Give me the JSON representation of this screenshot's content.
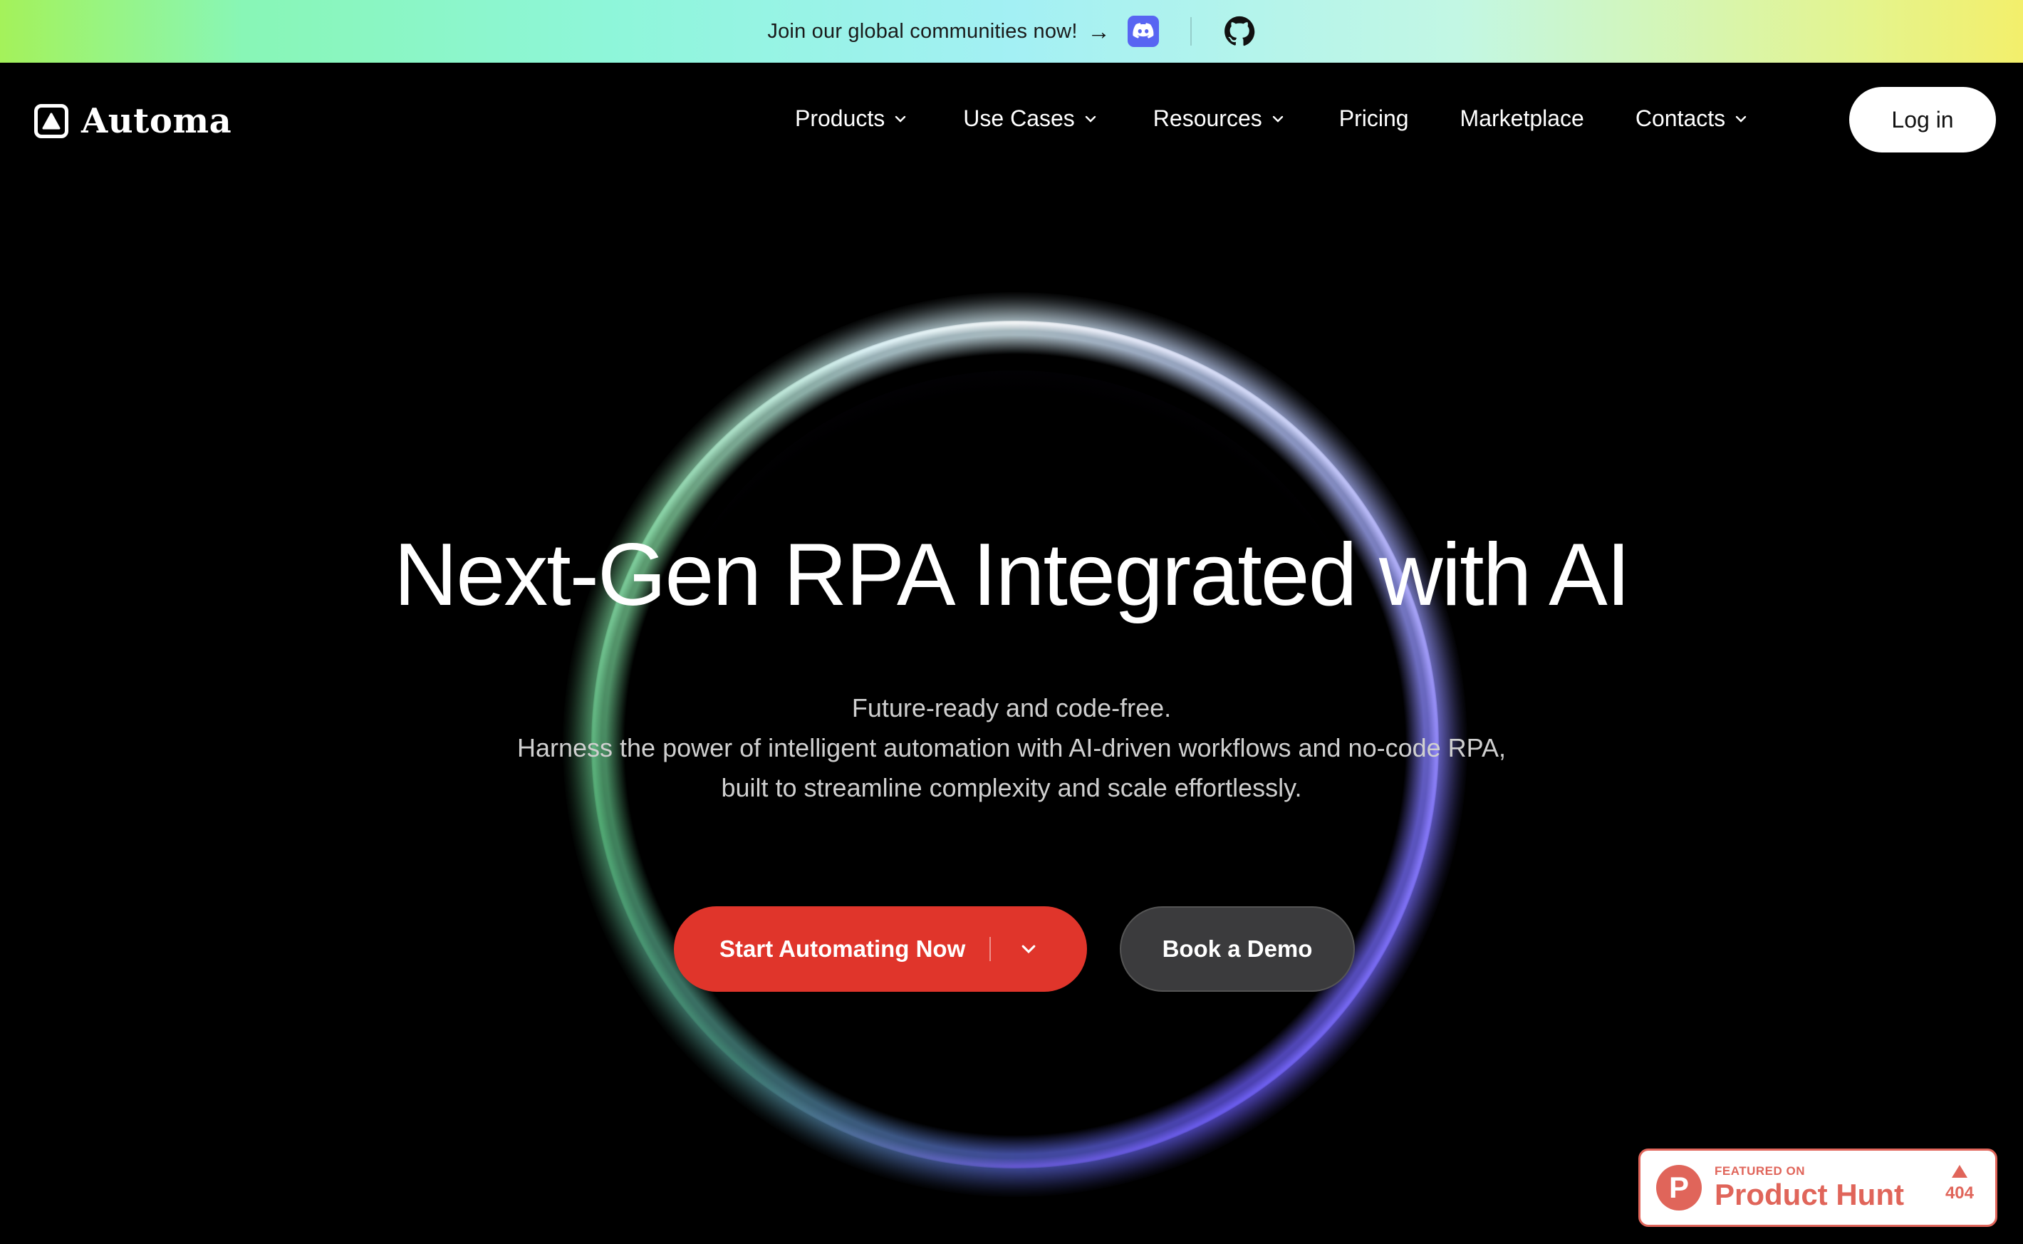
{
  "announcement": {
    "text": "Join our global communities now!",
    "arrow": "→",
    "icons": [
      "discord-icon",
      "github-icon"
    ]
  },
  "brand": {
    "name": "Automa"
  },
  "nav": {
    "items": [
      {
        "label": "Products",
        "has_dropdown": true
      },
      {
        "label": "Use Cases",
        "has_dropdown": true
      },
      {
        "label": "Resources",
        "has_dropdown": true
      },
      {
        "label": "Pricing",
        "has_dropdown": false
      },
      {
        "label": "Marketplace",
        "has_dropdown": false
      },
      {
        "label": "Contacts",
        "has_dropdown": true
      }
    ],
    "login_label": "Log in"
  },
  "hero": {
    "title": "Next-Gen RPA Integrated with AI",
    "subtitle_lines": [
      "Future-ready and code-free.",
      "Harness the power of intelligent automation with AI-driven workflows and no-code RPA,",
      "built to streamline complexity and scale effortlessly."
    ],
    "primary_cta": "Start Automating Now",
    "secondary_cta": "Book a Demo"
  },
  "product_hunt": {
    "small": "FEATURED ON",
    "big": "Product Hunt",
    "logo_letter": "P",
    "votes": "404"
  },
  "colors": {
    "primary_cta": "#e0352b",
    "secondary_cta": "#3b3b3d",
    "discord": "#5865f2",
    "product_hunt": "#e0655a"
  }
}
